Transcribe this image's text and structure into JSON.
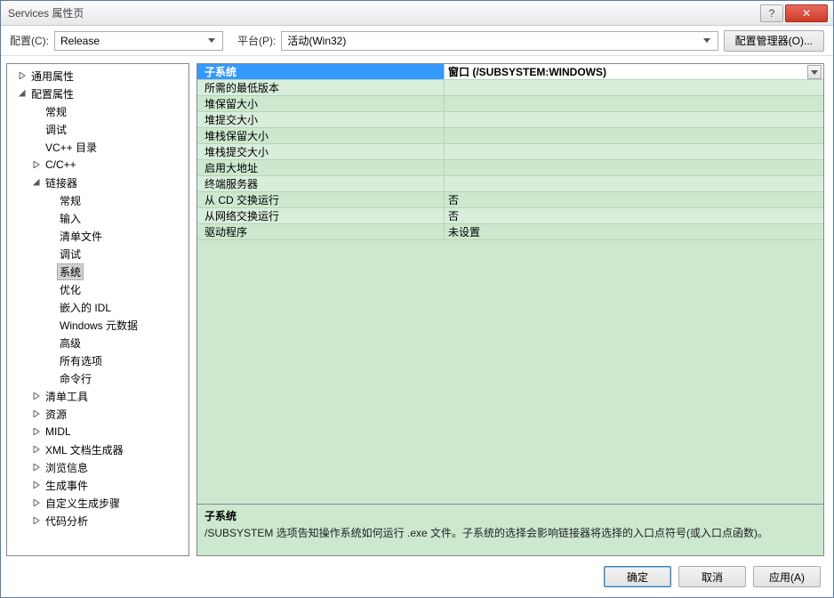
{
  "window": {
    "title": "Services 属性页",
    "help": "?",
    "close": "✕"
  },
  "toolbar": {
    "config_label": "配置(C):",
    "config_value": "Release",
    "platform_label": "平台(P):",
    "platform_value": "活动(Win32)",
    "config_mgr": "配置管理器(O)..."
  },
  "tree": [
    {
      "label": "通用属性",
      "depth": 0,
      "exp": "closed"
    },
    {
      "label": "配置属性",
      "depth": 0,
      "exp": "open"
    },
    {
      "label": "常规",
      "depth": 1,
      "exp": "none"
    },
    {
      "label": "调试",
      "depth": 1,
      "exp": "none"
    },
    {
      "label": "VC++ 目录",
      "depth": 1,
      "exp": "none"
    },
    {
      "label": "C/C++",
      "depth": 1,
      "exp": "closed"
    },
    {
      "label": "链接器",
      "depth": 1,
      "exp": "open"
    },
    {
      "label": "常规",
      "depth": 2,
      "exp": "none"
    },
    {
      "label": "输入",
      "depth": 2,
      "exp": "none"
    },
    {
      "label": "清单文件",
      "depth": 2,
      "exp": "none"
    },
    {
      "label": "调试",
      "depth": 2,
      "exp": "none"
    },
    {
      "label": "系统",
      "depth": 2,
      "exp": "none",
      "selected": true
    },
    {
      "label": "优化",
      "depth": 2,
      "exp": "none"
    },
    {
      "label": "嵌入的 IDL",
      "depth": 2,
      "exp": "none"
    },
    {
      "label": "Windows 元数据",
      "depth": 2,
      "exp": "none"
    },
    {
      "label": "高级",
      "depth": 2,
      "exp": "none"
    },
    {
      "label": "所有选项",
      "depth": 2,
      "exp": "none"
    },
    {
      "label": "命令行",
      "depth": 2,
      "exp": "none"
    },
    {
      "label": "清单工具",
      "depth": 1,
      "exp": "closed"
    },
    {
      "label": "资源",
      "depth": 1,
      "exp": "closed"
    },
    {
      "label": "MIDL",
      "depth": 1,
      "exp": "closed"
    },
    {
      "label": "XML 文档生成器",
      "depth": 1,
      "exp": "closed"
    },
    {
      "label": "浏览信息",
      "depth": 1,
      "exp": "closed"
    },
    {
      "label": "生成事件",
      "depth": 1,
      "exp": "closed"
    },
    {
      "label": "自定义生成步骤",
      "depth": 1,
      "exp": "closed"
    },
    {
      "label": "代码分析",
      "depth": 1,
      "exp": "closed"
    }
  ],
  "grid": [
    {
      "name": "子系统",
      "value": "窗口 (/SUBSYSTEM:WINDOWS)",
      "selected": true
    },
    {
      "name": "所需的最低版本",
      "value": ""
    },
    {
      "name": "堆保留大小",
      "value": ""
    },
    {
      "name": "堆提交大小",
      "value": ""
    },
    {
      "name": "堆栈保留大小",
      "value": ""
    },
    {
      "name": "堆栈提交大小",
      "value": ""
    },
    {
      "name": "启用大地址",
      "value": ""
    },
    {
      "name": "终端服务器",
      "value": ""
    },
    {
      "name": "从 CD 交换运行",
      "value": "否"
    },
    {
      "name": "从网络交换运行",
      "value": "否"
    },
    {
      "name": "驱动程序",
      "value": "未设置"
    }
  ],
  "desc": {
    "title": "子系统",
    "body": "/SUBSYSTEM 选项告知操作系统如何运行 .exe 文件。子系统的选择会影响链接器将选择的入口点符号(或入口点函数)。"
  },
  "buttons": {
    "ok": "确定",
    "cancel": "取消",
    "apply": "应用(A)"
  }
}
